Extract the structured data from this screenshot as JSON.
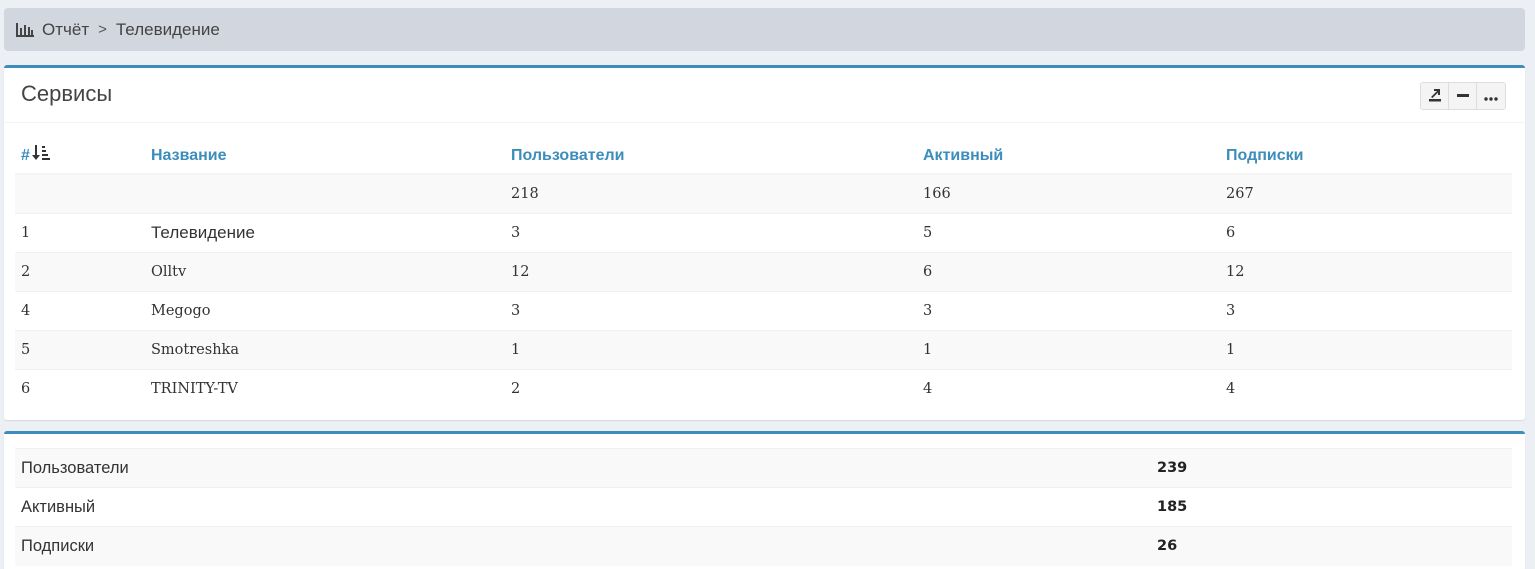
{
  "breadcrumb": {
    "icon": "bar-chart-icon",
    "root": "Отчёт",
    "separator": ">",
    "current": "Телевидение"
  },
  "services_box": {
    "title": "Сервисы",
    "tools": [
      "export-icon",
      "minus-icon",
      "ellipsis-icon"
    ],
    "columns": {
      "num": "#",
      "name": "Название",
      "users": "Пользователи",
      "active": "Активный",
      "subscriptions": "Подписки"
    },
    "totals": {
      "num": "",
      "name": "",
      "users": "218",
      "active": "166",
      "subscriptions": "267"
    },
    "rows": [
      {
        "num": "1",
        "name": "Телевидение",
        "users": "3",
        "active": "5",
        "subscriptions": "6"
      },
      {
        "num": "2",
        "name": "Olltv",
        "users": "12",
        "active": "6",
        "subscriptions": "12"
      },
      {
        "num": "4",
        "name": "Megogo",
        "users": "3",
        "active": "3",
        "subscriptions": "3"
      },
      {
        "num": "5",
        "name": "Smotreshka",
        "users": "1",
        "active": "1",
        "subscriptions": "1"
      },
      {
        "num": "6",
        "name": "TRINITY-TV",
        "users": "2",
        "active": "4",
        "subscriptions": "4"
      }
    ]
  },
  "summary_box": {
    "rows": [
      {
        "label": "Пользователи",
        "value": "239"
      },
      {
        "label": "Активный",
        "value": "185"
      },
      {
        "label": "Подписки",
        "value": "26"
      }
    ]
  },
  "colors": {
    "accent": "#3c8dbc",
    "breadcrumb_bg": "#d2d6de",
    "page_bg": "#ecf0f5"
  }
}
